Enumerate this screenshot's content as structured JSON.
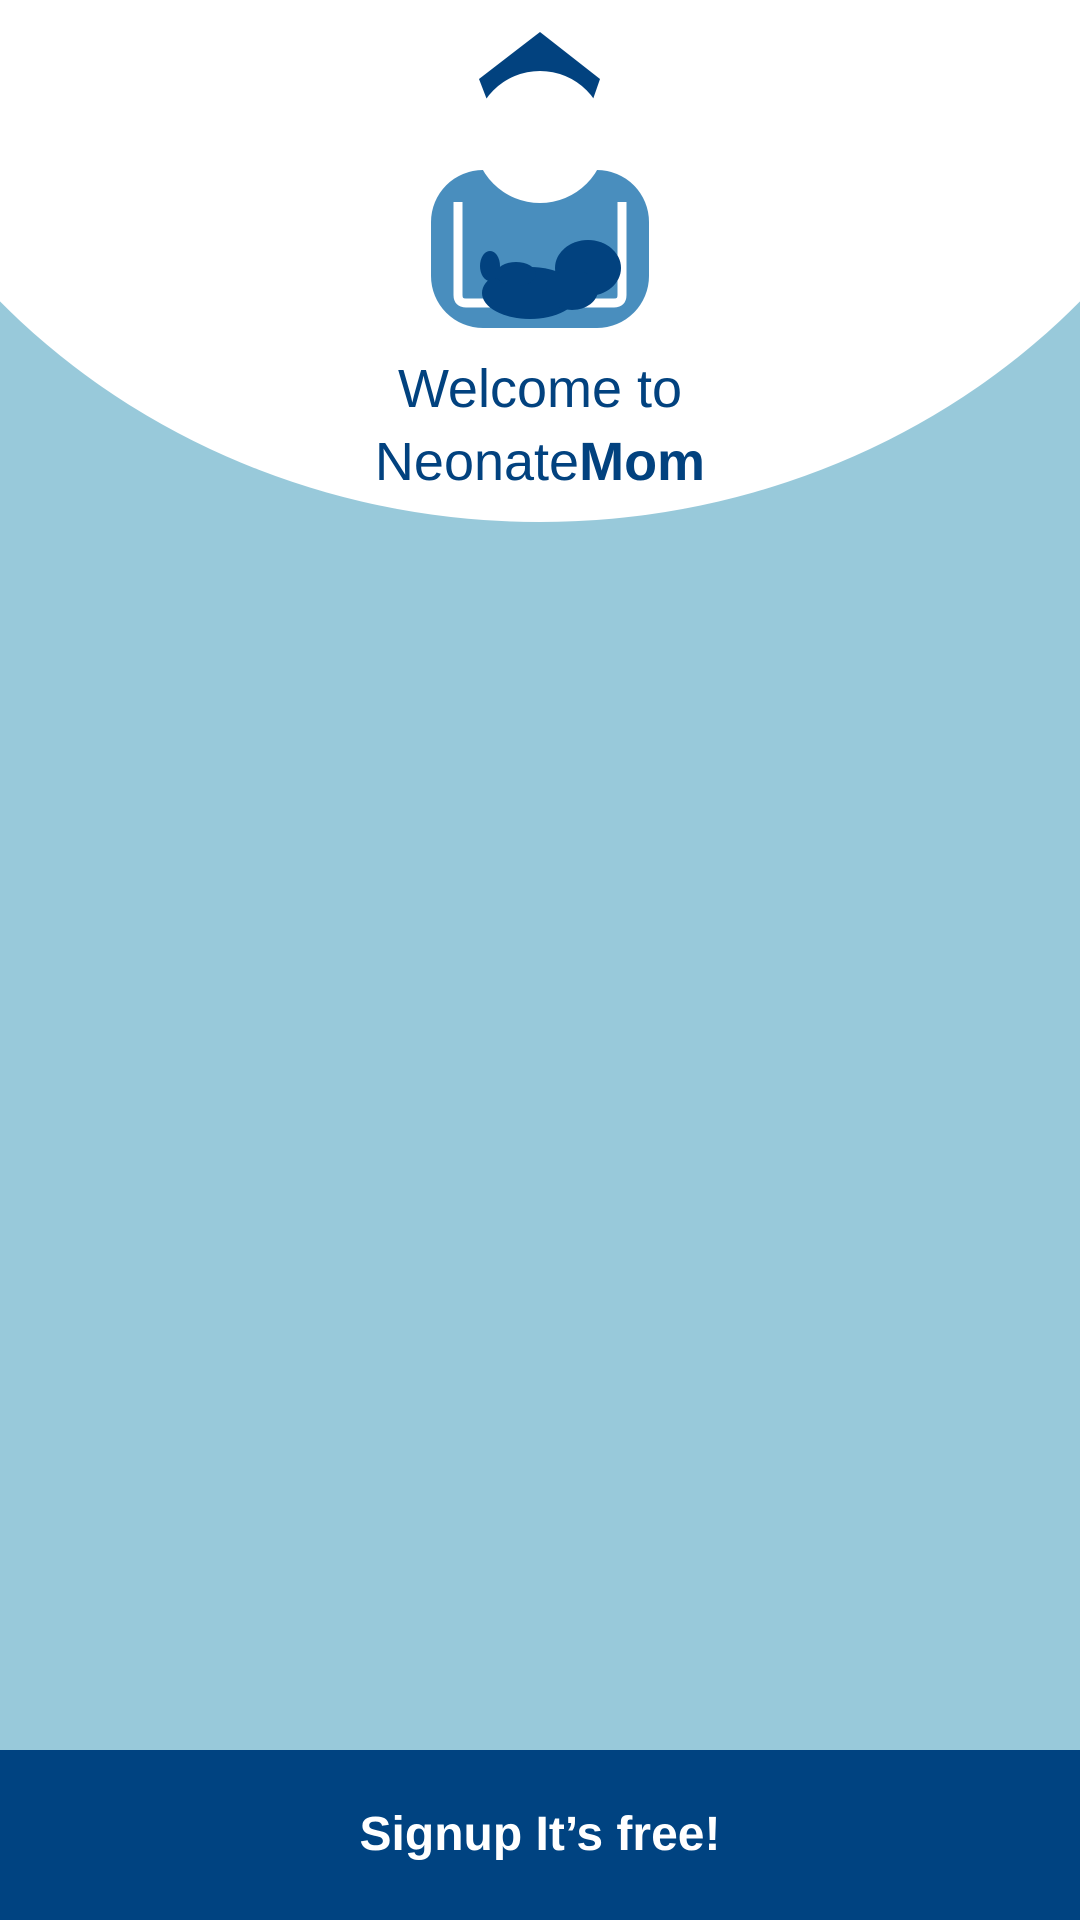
{
  "welcome": {
    "line1": "Welcome to",
    "brand_light": "Neonate",
    "brand_bold": "Mom"
  },
  "signup": {
    "label": "Signup It’s free!"
  },
  "icons": {
    "logo": "neonatemom-logo"
  },
  "colors": {
    "background": "#98c9da",
    "header": "#ffffff",
    "brand_dark": "#02427f",
    "logo_mid": "#498ebe",
    "button": "#004381",
    "button_text": "#ffffff"
  }
}
